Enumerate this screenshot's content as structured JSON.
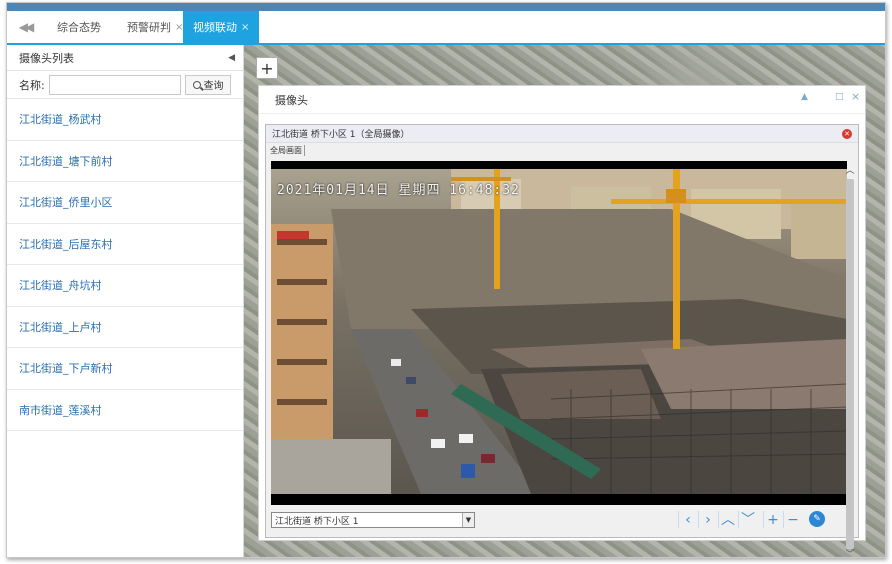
{
  "tabs": {
    "items": [
      {
        "label": "综合态势",
        "closable": false
      },
      {
        "label": "预警研判",
        "closable": true
      },
      {
        "label": "视频联动",
        "closable": true
      }
    ],
    "active_index": 2,
    "nav_icon": "double-chevron-left-icon",
    "close_glyph": "×"
  },
  "sidebar": {
    "title": "摄像头列表",
    "collapse_glyph": "◀",
    "search": {
      "label": "名称:",
      "value": "",
      "placeholder": "",
      "button_label": "查询"
    },
    "items": [
      {
        "label": "江北街道_杨武村"
      },
      {
        "label": "江北街道_塘下前村"
      },
      {
        "label": "江北街道_侨里小区"
      },
      {
        "label": "江北街道_后屋东村"
      },
      {
        "label": "江北街道_舟坑村"
      },
      {
        "label": "江北街道_上卢村"
      },
      {
        "label": "江北街道_下卢新村"
      },
      {
        "label": "南市街道_莲溪村"
      }
    ]
  },
  "map": {
    "zoom_in_label": "+"
  },
  "camera_window": {
    "title": "摄像头",
    "minimize_glyph": "▲",
    "maximize_glyph": "□",
    "close_glyph": "×",
    "feed_title": "江北街道 桥下小区 1（全局摄像）",
    "sub_tab": "全局画面",
    "osd_text": "2021年01月14日 星期四 16:48:32",
    "selected_camera": "江北街道 桥下小区 1",
    "select_arrow": "▼",
    "ptz": {
      "left": "‹",
      "right": "›",
      "up": "︿",
      "down": "﹀",
      "zoom_in": "+",
      "zoom_out": "−",
      "settings": "✎"
    },
    "scroll_up": "︿",
    "scroll_down": "﹀"
  },
  "colors": {
    "accent": "#1ea3e0",
    "link": "#2a6fb0",
    "top_strip": "#4a86b8",
    "ptz": "#3b8fd6",
    "close_red": "#d63b2f"
  }
}
